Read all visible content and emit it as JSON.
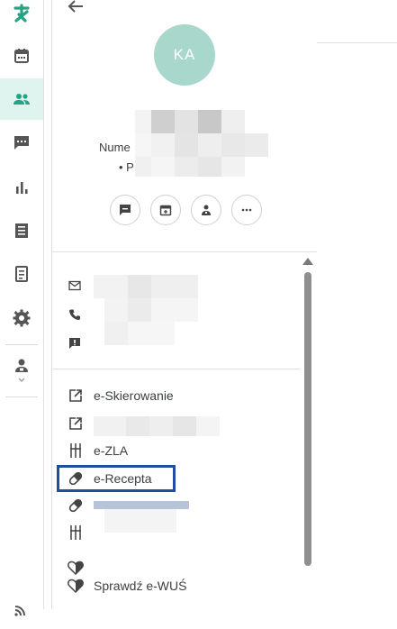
{
  "app": {
    "accent": "#26a383"
  },
  "rail": {
    "items": [
      {
        "icon": "logo-icon"
      },
      {
        "icon": "calendar-icon"
      },
      {
        "icon": "patients-icon",
        "active": true
      },
      {
        "icon": "chat-icon"
      },
      {
        "icon": "stats-icon"
      },
      {
        "icon": "invoice-icon"
      },
      {
        "icon": "document-icon"
      },
      {
        "icon": "settings-icon"
      },
      {
        "icon": "doctor-icon"
      },
      {
        "icon": "signal-icon"
      }
    ]
  },
  "profile": {
    "avatar_initials": "KA",
    "number_label": "Nume",
    "p_label": "• P"
  },
  "menu": {
    "items": [
      {
        "icon": "external-link-icon",
        "label": "e-Skierowanie"
      },
      {
        "icon": "external-link-icon",
        "label": ""
      },
      {
        "icon": "zla-icon",
        "label": "e-ZLA"
      },
      {
        "icon": "pill-icon",
        "label": "e-Recepta"
      },
      {
        "icon": "pill-icon",
        "label": ""
      },
      {
        "icon": "zla-icon",
        "label": ""
      },
      {
        "icon": "heart-icon",
        "label": ""
      },
      {
        "icon": "heart-icon",
        "label": "Sprawdź e-WUŚ"
      }
    ]
  }
}
